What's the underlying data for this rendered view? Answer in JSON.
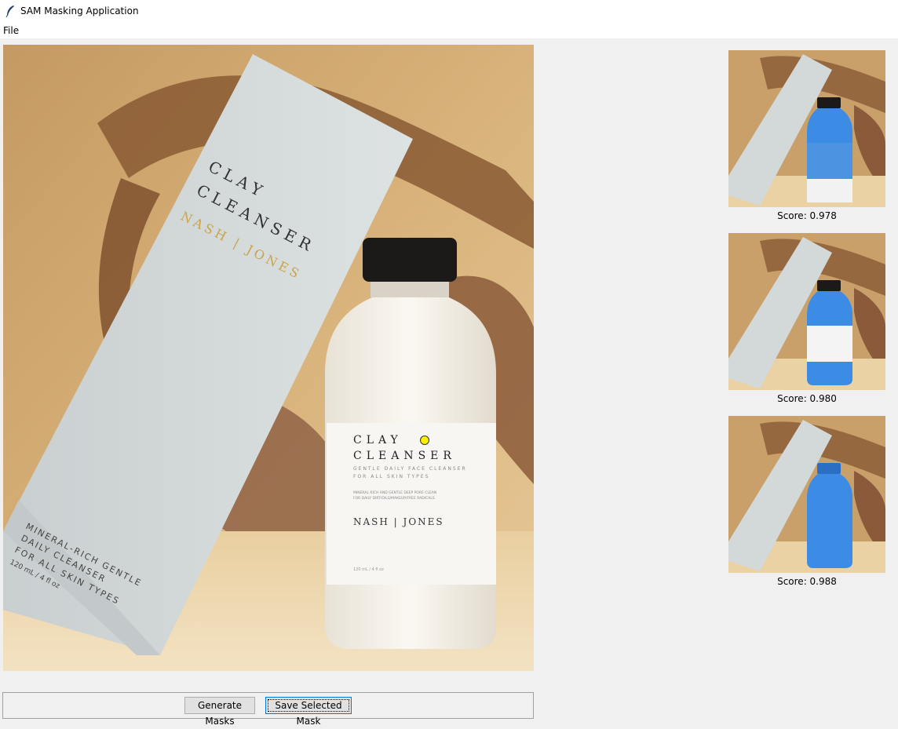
{
  "window": {
    "title": "SAM Masking Application"
  },
  "menu": {
    "file_label": "File"
  },
  "main_image": {
    "box_text": {
      "line1": "CLAY",
      "line2": "CLEANSER",
      "brand": "NASH | JONES",
      "bottom1": "MINERAL-RICH GENTLE",
      "bottom2": "DAILY CLEANSER",
      "bottom3": "FOR ALL SKIN TYPES",
      "bottom4": "120 mL / 4 fl oz"
    },
    "bottle_text": {
      "line1": "CLAY",
      "line2": "CLEANSER",
      "sub1": "GENTLE DAILY FACE CLEANSER",
      "sub2": "FOR ALL SKIN TYPES",
      "small1": "MINERAL RICH AND GENTLE DEEP PORE CLEAN",
      "small2": "FOR DAILY DIRT/OILS/MAKEUP/FREE RADICALS",
      "brand": "NASH | JONES",
      "volume": "120 mL / 4 fl oz"
    }
  },
  "thumbnails": [
    {
      "score": "Score: 0.978"
    },
    {
      "score": "Score: 0.980"
    },
    {
      "score": "Score: 0.988"
    }
  ],
  "buttons": {
    "generate": "Generate Masks",
    "save": "Save Selected Mask"
  },
  "colors": {
    "mask_blue": "#3c8ce6",
    "point_yellow": "#ffee00"
  }
}
